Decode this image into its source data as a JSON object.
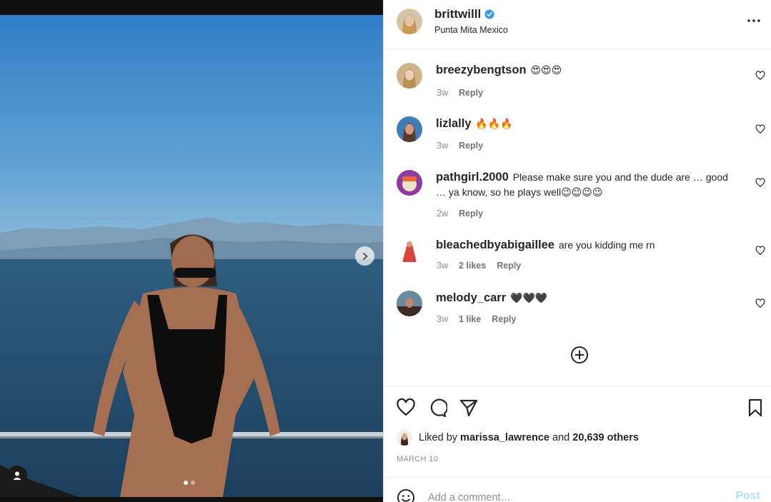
{
  "post": {
    "username": "brittwilll",
    "location": "Punta Mita Mexico",
    "carousel": {
      "slide": 1,
      "total": 2
    }
  },
  "comments": [
    {
      "username": "breezybengtson",
      "text": "😍😍😍",
      "time": "3w",
      "likes": "",
      "reply": "Reply",
      "avatar_color": "#c9a36a"
    },
    {
      "username": "lizlally",
      "text": "🔥🔥🔥",
      "time": "3w",
      "likes": "",
      "reply": "Reply",
      "avatar_color": "#b46a4c"
    },
    {
      "username": "pathgirl.2000",
      "text": "Please make sure you and the dude are … good … ya know, so he plays well😉😉😉😉",
      "time": "2w",
      "likes": "",
      "reply": "Reply",
      "avatar_color": "#9b3fa8"
    },
    {
      "username": "bleachedbyabigaillee",
      "text": "are you kidding me rn",
      "time": "3w",
      "likes": "2 likes",
      "reply": "Reply",
      "avatar_color": "#d9443a"
    },
    {
      "username": "melody_carr",
      "text": "🖤🖤🖤",
      "time": "3w",
      "likes": "1 like",
      "reply": "Reply",
      "avatar_color": "#7a5a45"
    }
  ],
  "likes": {
    "prefix": "Liked by",
    "user": "marissa_lawrence",
    "and": "and",
    "others": "20,639 others"
  },
  "date": "MARCH 10",
  "composer": {
    "placeholder": "Add a comment…",
    "post_label": "Post"
  },
  "colors": {
    "accent_disabled": "#b2dffc",
    "verified": "#3897f0",
    "text": "#262626",
    "muted": "#8e8e8e"
  },
  "icons": [
    "verified-badge-icon",
    "more-options-icon",
    "heart-icon",
    "comment-icon",
    "share-icon",
    "bookmark-icon",
    "add-circle-icon",
    "emoji-icon",
    "chevron-right-icon",
    "user-tag-icon"
  ]
}
